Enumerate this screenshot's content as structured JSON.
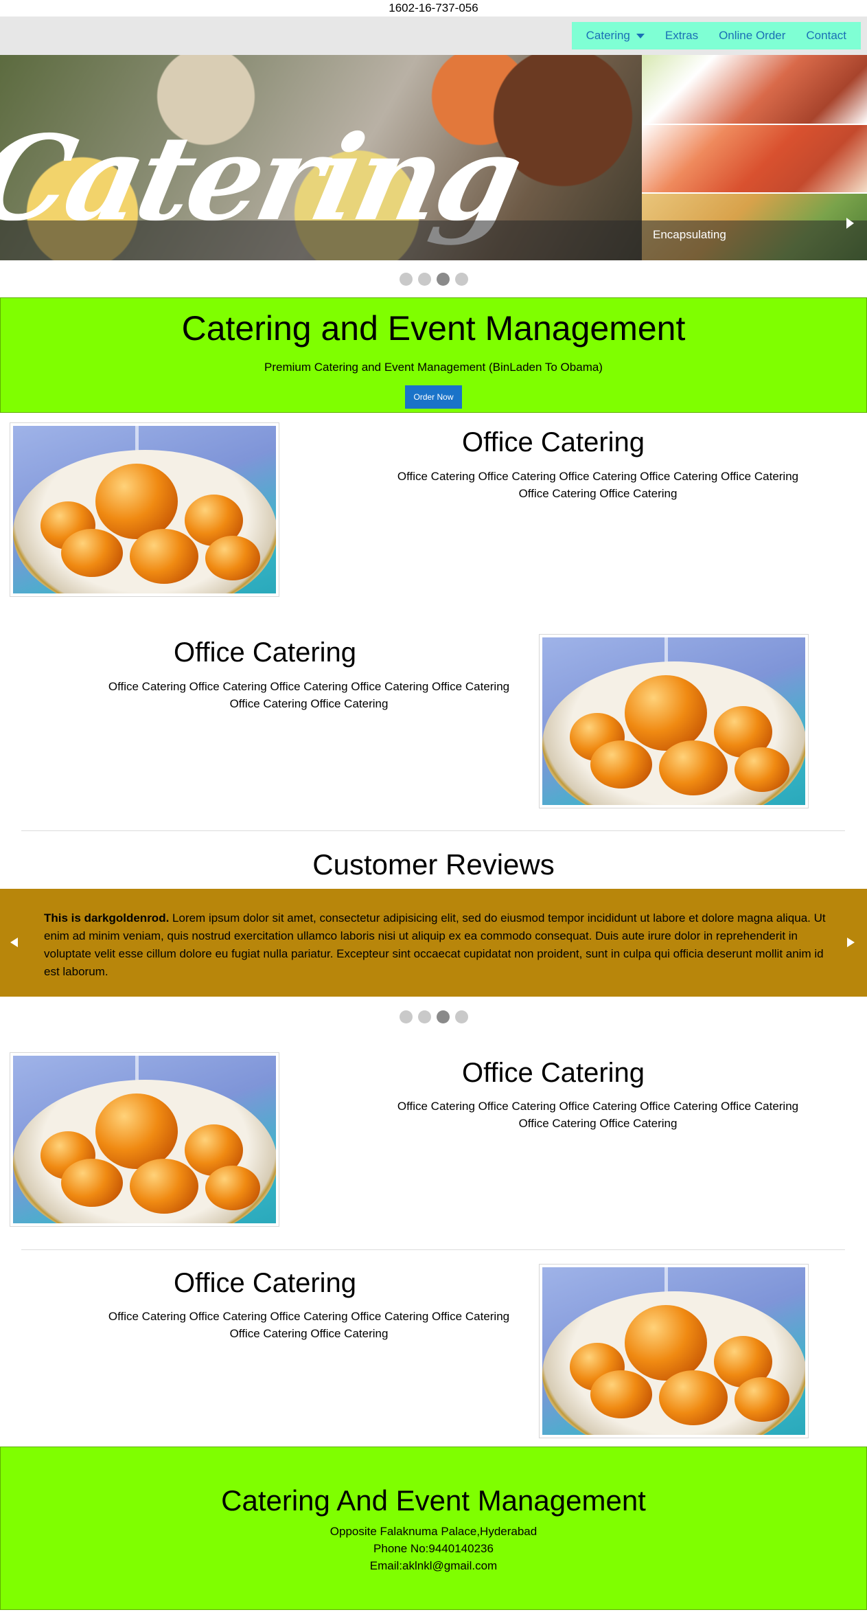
{
  "topbar": {
    "phone": "1602-16-737-056"
  },
  "nav": {
    "items": [
      {
        "label": "Catering",
        "has_dropdown": true
      },
      {
        "label": "Extras"
      },
      {
        "label": "Online Order"
      },
      {
        "label": "Contact"
      }
    ],
    "menu_bg": "#7fffd4",
    "link_color": "#1a6fb5"
  },
  "hero": {
    "overlay_word": "Catering",
    "caption": "Encapsulating",
    "dots": 4,
    "active_dot": 3
  },
  "banner": {
    "title": "Catering and Event Management",
    "subtitle": "Premium Catering and Event Management (BinLaden To Obama)",
    "cta": "Order Now",
    "bg": "#7fff00"
  },
  "features": [
    {
      "title": "Office Catering",
      "text": "Office Catering Office Catering Office Catering Office Catering Office Catering Office Catering Office Catering"
    },
    {
      "title": "Office Catering",
      "text": "Office Catering Office Catering Office Catering Office Catering Office Catering Office Catering Office Catering"
    },
    {
      "title": "Office Catering",
      "text": "Office Catering Office Catering Office Catering Office Catering Office Catering Office Catering Office Catering"
    },
    {
      "title": "Office Catering",
      "text": "Office Catering Office Catering Office Catering Office Catering Office Catering Office Catering Office Catering"
    }
  ],
  "reviews": {
    "title": "Customer Reviews",
    "bold": "This is darkgoldenrod.",
    "text": " Lorem ipsum dolor sit amet, consectetur adipisicing elit, sed do eiusmod tempor incididunt ut labore et dolore magna aliqua. Ut enim ad minim veniam, quis nostrud exercitation ullamco laboris nisi ut aliquip ex ea commodo consequat. Duis aute irure dolor in reprehenderit in voluptate velit esse cillum dolore eu fugiat nulla pariatur. Excepteur sint occaecat cupidatat non proident, sunt in culpa qui officia deserunt mollit anim id est laborum.",
    "bg": "#b8860b",
    "dots": 4,
    "active_dot": 3
  },
  "footer": {
    "title": "Catering And Event Management",
    "address": "Opposite Falaknuma Palace,Hyderabad",
    "phone": "Phone No:9440140236",
    "email": "Email:aklnkl@gmail.com"
  }
}
